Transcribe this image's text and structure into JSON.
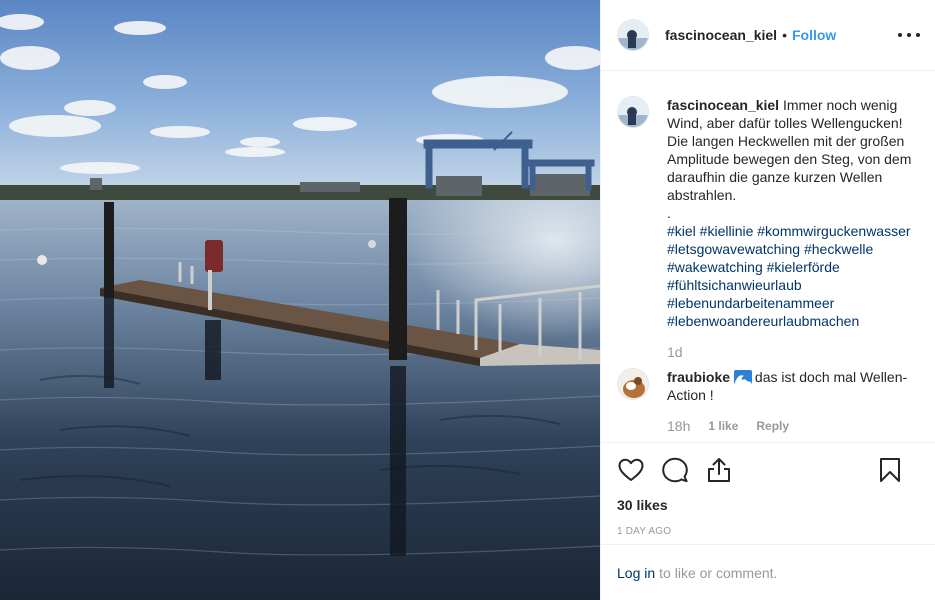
{
  "post": {
    "username": "fascinocean_kiel",
    "header_dot": "•",
    "follow_label": "Follow",
    "caption": {
      "username": "fascinocean_kiel",
      "text": "Immer noch wenig Wind, aber dafür tolles Wellengucken! Die langen Heckwellen mit der großen Amplitude bewegen den Steg, von dem daraufhin die ganze kurzen Wellen abstrahlen.",
      "separator": ".",
      "hashtags": [
        "#kiel #kiellinie #kommwirguckenwasser",
        "#letsgowavewatching #heckwelle",
        "#wakewatching #kielerförde",
        "#fühltsichanwieurlaub",
        "#lebenundarbeitenammeer",
        "#lebenwoandereurlaubmachen"
      ],
      "time": "1d"
    },
    "comments": [
      {
        "username": "fraubioke",
        "emoji_icon": "water-wave-icon",
        "text": "das ist doch mal Wellen-Action !",
        "time": "18h",
        "likes": "1 like",
        "reply_label": "Reply"
      }
    ],
    "likes_label": "30 likes",
    "date_label": "1 day ago",
    "login_link": "Log in",
    "login_text": "to like or comment."
  },
  "icons": {
    "more": "more-options-icon",
    "like": "heart-icon",
    "comment": "comment-icon",
    "share": "share-icon",
    "save": "bookmark-icon"
  },
  "colors": {
    "link_blue": "#3897f0",
    "hashtag": "#003569",
    "muted": "#999999",
    "text": "#262626"
  }
}
